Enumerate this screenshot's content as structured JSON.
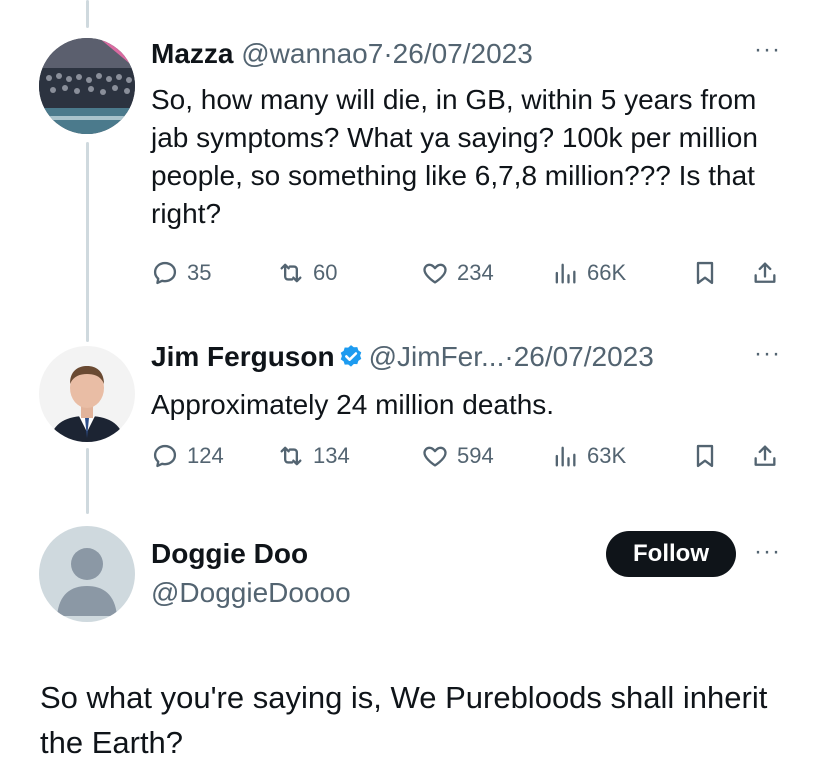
{
  "tweets": [
    {
      "name": "Mazza",
      "handle": "@wannao7",
      "separator": "·",
      "date": "26/07/2023",
      "more": "···",
      "text": "So, how many will die, in GB, within 5 years from  jab symptoms? What ya saying? 100k per million people, so something like 6,7,8 million???  Is that right?",
      "replies": "35",
      "retweets": "60",
      "likes": "234",
      "views": "66K"
    },
    {
      "name": "Jim Ferguson",
      "handle": "@JimFer...",
      "separator": "·",
      "date": "26/07/2023",
      "more": "···",
      "verified": true,
      "text": "Approximately 24 million deaths.",
      "replies": "124",
      "retweets": "134",
      "likes": "594",
      "views": "63K"
    }
  ],
  "main": {
    "name": "Doggie Doo",
    "handle": "@DoggieDoooo",
    "follow_label": "Follow",
    "more": "···",
    "text": "So what you're saying is, We Purebloods shall inherit the Earth?"
  },
  "colors": {
    "text": "#0f1419",
    "secondary": "#536471",
    "thread_line": "#cfd9de",
    "verified": "#1d9bf0",
    "follow_bg": "#0f1419"
  }
}
